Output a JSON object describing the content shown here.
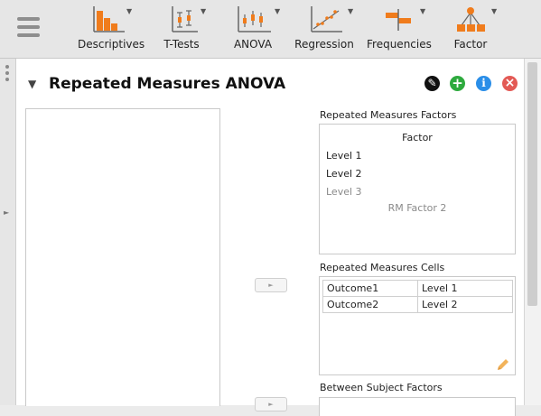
{
  "ribbon": {
    "tools": [
      {
        "label": "Descriptives",
        "icon": "descriptives-icon"
      },
      {
        "label": "T-Tests",
        "icon": "t-tests-icon"
      },
      {
        "label": "ANOVA",
        "icon": "anova-icon"
      },
      {
        "label": "Regression",
        "icon": "regression-icon"
      },
      {
        "label": "Frequencies",
        "icon": "frequencies-icon"
      },
      {
        "label": "Factor",
        "icon": "factor-icon"
      }
    ]
  },
  "analysis": {
    "title": "Repeated Measures ANOVA",
    "buttons": {
      "edit": "✎",
      "add": "+",
      "info": "i",
      "close": "×"
    },
    "colors": {
      "edit": "#111111",
      "add": "#2eaa3e",
      "info": "#2a8ee8",
      "close": "#e35a55"
    }
  },
  "rm_factors": {
    "label": "Repeated Measures Factors",
    "header": "Factor",
    "levels": [
      "Level 1",
      "Level 2"
    ],
    "level_placeholder": "Level 3",
    "factor_placeholder": "RM Factor 2"
  },
  "rm_cells": {
    "label": "Repeated Measures Cells",
    "rows": [
      {
        "outcome": "Outcome1",
        "level": "Level 1"
      },
      {
        "outcome": "Outcome2",
        "level": "Level 2"
      }
    ]
  },
  "between": {
    "label": "Between Subject Factors"
  },
  "assign_arrow": "►",
  "colors": {
    "accent": "#f07c1c",
    "ribbon_bg": "#e6e6e6",
    "panel_bg": "#ffffff"
  }
}
